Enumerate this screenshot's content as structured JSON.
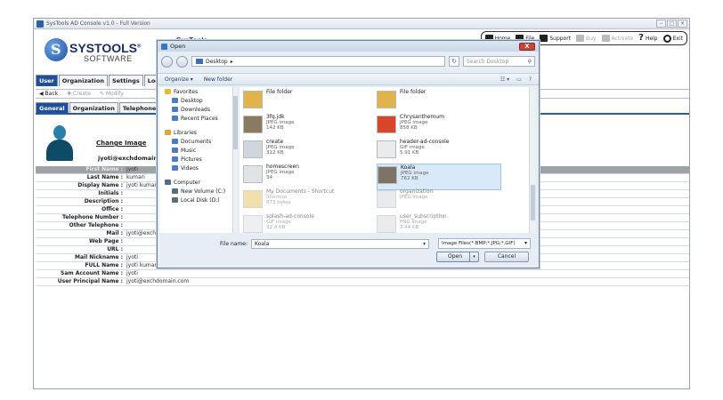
{
  "window": {
    "title": "SysTools AD Console v1.0 - Full Version"
  },
  "logo": {
    "brand": "SYSTOOLS",
    "sub": "SOFTWARE",
    "registered": "®"
  },
  "product_label": "SysTools",
  "toolbar": {
    "items": [
      {
        "label": "Home",
        "icon": "home-icon"
      },
      {
        "label": "File",
        "icon": "folder-icon"
      },
      {
        "label": "Support",
        "icon": "support-icon"
      },
      {
        "label": "Buy",
        "icon": "cart-icon",
        "disabled": true
      },
      {
        "label": "Activate",
        "icon": "key-icon",
        "disabled": true
      },
      {
        "label": "Help",
        "icon": "help-icon"
      },
      {
        "label": "Exit",
        "icon": "power-icon"
      }
    ]
  },
  "main_tabs": [
    "User",
    "Organization",
    "Settings",
    "Log"
  ],
  "nav": {
    "back": "Back",
    "create": "Create",
    "modify": "Modify"
  },
  "detail_tabs": [
    "General",
    "Organization",
    "Telephones"
  ],
  "profile": {
    "change_image": "Change Image",
    "email": "jyoti@exchdomain."
  },
  "fields": [
    {
      "label": "First Name :",
      "value": "jyoti",
      "head": true
    },
    {
      "label": "Last Name :",
      "value": "kumari"
    },
    {
      "label": "Display Name :",
      "value": "jyoti kumar"
    },
    {
      "label": "Initials :",
      "value": ""
    },
    {
      "label": "Description :",
      "value": ""
    },
    {
      "label": "Office :",
      "value": ""
    },
    {
      "label": "Telephone Number :",
      "value": ""
    },
    {
      "label": "Other Telephone :",
      "value": ""
    },
    {
      "label": "Mail :",
      "value": "jyoti@exch"
    },
    {
      "label": "Web Page :",
      "value": ""
    },
    {
      "label": "URL :",
      "value": ""
    },
    {
      "label": "Mail Nickname :",
      "value": "jyoti"
    },
    {
      "label": "FULL Name :",
      "value": "jyoti kumari"
    },
    {
      "label": "Sam Account Name :",
      "value": "jyoti"
    },
    {
      "label": "User Principal Name :",
      "value": "jyoti@exchdomain.com"
    }
  ],
  "dialog": {
    "title": "Open",
    "close": "X",
    "path": "Desktop",
    "search_placeholder": "Search Desktop",
    "organize": "Organize ▾",
    "new_folder": "New folder",
    "nav_items": [
      {
        "label": "Favorites",
        "icon": "star-icon",
        "level": 0
      },
      {
        "label": "Desktop",
        "icon": "desktop-icon",
        "level": 1
      },
      {
        "label": "Downloads",
        "icon": "downloads-icon",
        "level": 1
      },
      {
        "label": "Recent Places",
        "icon": "recent-icon",
        "level": 1
      },
      {
        "label": "Libraries",
        "icon": "library-icon",
        "level": 0
      },
      {
        "label": "Documents",
        "icon": "documents-icon",
        "level": 1
      },
      {
        "label": "Music",
        "icon": "music-icon",
        "level": 1
      },
      {
        "label": "Pictures",
        "icon": "pictures-icon",
        "level": 1
      },
      {
        "label": "Videos",
        "icon": "videos-icon",
        "level": 1
      },
      {
        "label": "Computer",
        "icon": "computer-icon",
        "level": 0
      },
      {
        "label": "New Volume (C:)",
        "icon": "drive-icon",
        "level": 1
      },
      {
        "label": "Local Disk (D:)",
        "icon": "drive-icon",
        "level": 1
      }
    ],
    "files": [
      {
        "name": "File folder",
        "type": "",
        "size": "",
        "thumb": "#e0b44a"
      },
      {
        "name": "File folder",
        "type": "",
        "size": "",
        "thumb": "#e0b44a"
      },
      {
        "name": "3fq.jdk",
        "type": "JPEG image",
        "size": "142 KB",
        "thumb": "#8a7a60"
      },
      {
        "name": "Chrysanthemum",
        "type": "JPEG image",
        "size": "858 KB",
        "thumb": "#d8452a"
      },
      {
        "name": "create",
        "type": "JPEG image",
        "size": "312 KB",
        "thumb": "#cfd6de"
      },
      {
        "name": "header-ad-console",
        "type": "GIF image",
        "size": "5.91 KB",
        "thumb": "#e9ecef"
      },
      {
        "name": "homescreen",
        "type": "JPEG image",
        "size": "34",
        "thumb": "#dfe4e9"
      },
      {
        "name": "Koala",
        "type": "JPEG image",
        "size": "762 KB",
        "thumb": "#7d7466",
        "selected": true
      },
      {
        "name": "My Documents - Shortcut",
        "type": "Shortcut",
        "size": "873 bytes",
        "thumb": "#e8c86a",
        "dim": true
      },
      {
        "name": "organization",
        "type": "JPEG image",
        "size": "",
        "thumb": "#d5dbe1",
        "dim": true
      },
      {
        "name": "splash-ad-console",
        "type": "GIF image",
        "size": "32.4 KB",
        "thumb": "#dfe3e7",
        "dim": true
      },
      {
        "name": "user_subscription",
        "type": "PNG image",
        "size": "3.44 KB",
        "thumb": "#d8dde2",
        "dim": true
      }
    ],
    "filename_label": "File name:",
    "filename_value": "Koala",
    "filetype": "Image Files(*.BMP;*.JPG;*.GIF)",
    "open_label": "Open",
    "cancel_label": "Cancel"
  }
}
